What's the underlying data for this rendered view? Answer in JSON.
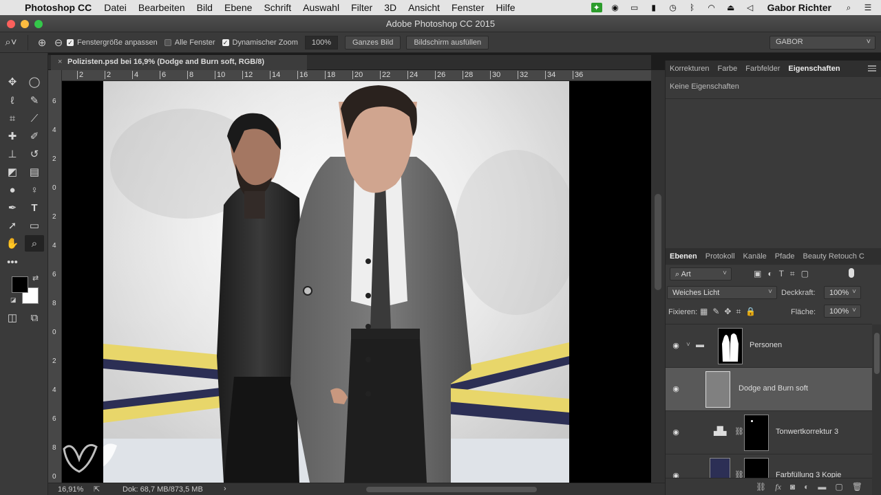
{
  "menubar": {
    "app_name": "Photoshop CC",
    "items": [
      "Datei",
      "Bearbeiten",
      "Bild",
      "Ebene",
      "Schrift",
      "Auswahl",
      "Filter",
      "3D",
      "Ansicht",
      "Fenster",
      "Hilfe"
    ],
    "user": "Gabor Richter"
  },
  "window": {
    "title": "Adobe Photoshop CC 2015"
  },
  "options": {
    "fit_window_label": "Fenstergröße anpassen",
    "all_windows_label": "Alle Fenster",
    "dynamic_zoom_label": "Dynamischer Zoom",
    "zoom_value": "100%",
    "fit_button": "Ganzes Bild",
    "fill_button": "Bildschirm ausfüllen",
    "workspace": "GABOR"
  },
  "document": {
    "tab_title": "Polizisten.psd bei 16,9% (Dodge and Burn soft, RGB/8)",
    "close_glyph": "×",
    "ruler_h_labels": [
      "2",
      "2",
      "4",
      "6",
      "8",
      "10",
      "12",
      "14",
      "16",
      "18",
      "20",
      "22",
      "24",
      "26",
      "28",
      "30",
      "32",
      "34",
      "36"
    ],
    "ruler_v_labels": [
      "6",
      "4",
      "2",
      "0",
      "2",
      "4",
      "6",
      "8",
      "0",
      "2",
      "4",
      "6",
      "8",
      "0"
    ]
  },
  "status": {
    "zoom": "16,91%",
    "doc_size": "Dok: 68,7 MB/873,5 MB",
    "arrow": "›"
  },
  "panels": {
    "top_tabs": [
      "Korrekturen",
      "Farbe",
      "Farbfelder",
      "Eigenschaften"
    ],
    "active_top_tab": "Eigenschaften",
    "no_properties": "Keine Eigenschaften",
    "layer_tabs": [
      "Ebenen",
      "Protokoll",
      "Kanäle",
      "Pfade",
      "Beauty Retouch C"
    ],
    "active_layer_tab": "Ebenen",
    "filter_kind": "Art",
    "blend_mode": "Weiches Licht",
    "opacity_label": "Deckkraft:",
    "opacity": "100%",
    "lock_label": "Fixieren:",
    "fill_label": "Fläche:",
    "fill": "100%",
    "layers": [
      {
        "name": "Personen"
      },
      {
        "name": "Dodge and Burn soft"
      },
      {
        "name": "Tonwertkorrektur 3"
      },
      {
        "name": "Farbfüllung 3 Kopie"
      }
    ]
  },
  "colors": {
    "foreground": "#000000",
    "background": "#ffffff",
    "tape_yellow": "#e8d66a",
    "tape_navy": "#2c2f55"
  }
}
